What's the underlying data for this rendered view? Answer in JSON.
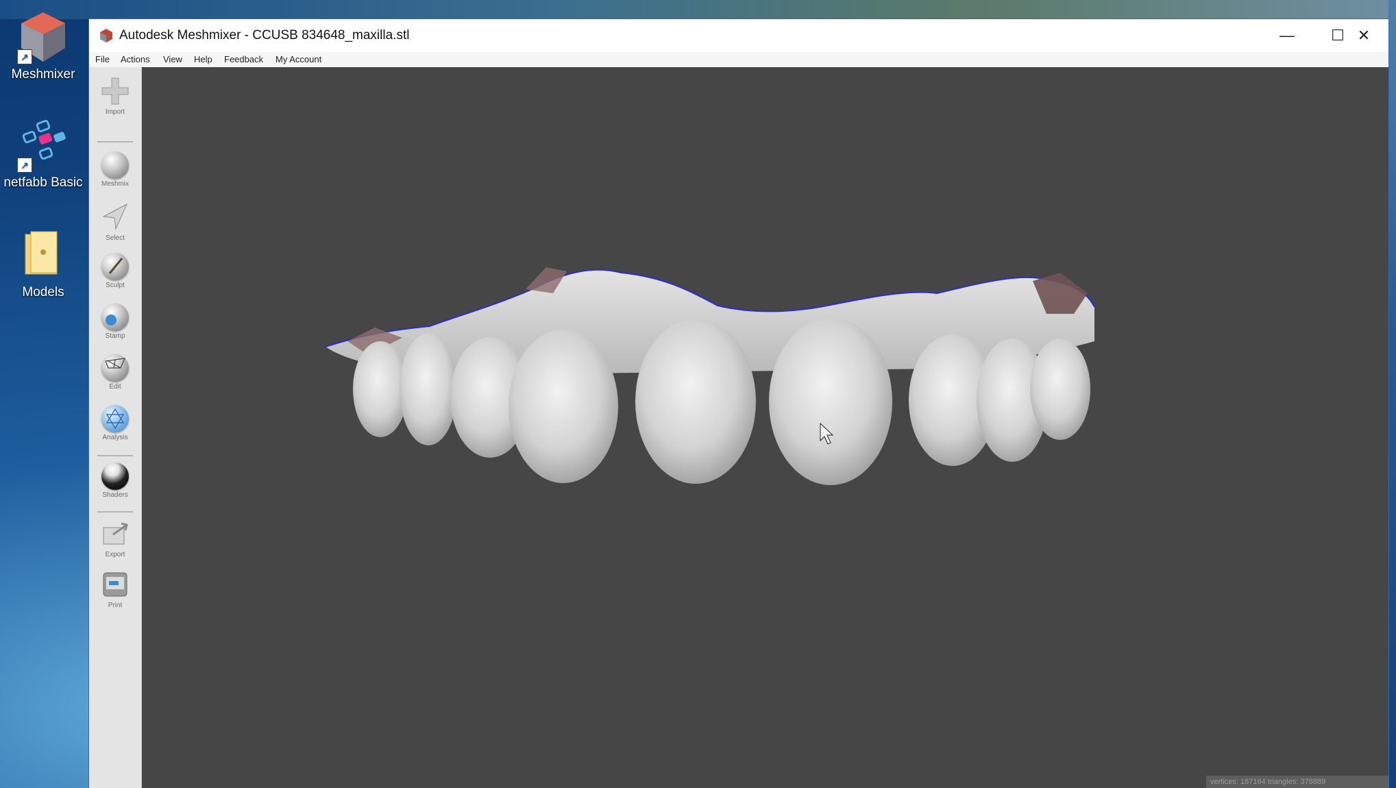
{
  "desktop": {
    "icons": [
      {
        "label": "Meshmixer",
        "icon": "meshmixer-icon"
      },
      {
        "label": "netfabb Basic",
        "icon": "netfabb-icon"
      },
      {
        "label": "Models",
        "icon": "folder-icon"
      }
    ]
  },
  "window": {
    "title": "Autodesk Meshmixer - CCUSB 834648_maxilla.stl",
    "controls": {
      "minimize": "—",
      "maximize": "☐",
      "close": "✕"
    }
  },
  "menu": [
    "File",
    "Actions",
    "View",
    "Help",
    "Feedback",
    "My Account"
  ],
  "toolbar": [
    {
      "label": "Import",
      "icon": "import-plus-icon"
    },
    {
      "label": "Meshmix",
      "icon": "meshmix-sphere-icon"
    },
    {
      "label": "Select",
      "icon": "select-arrow-icon"
    },
    {
      "label": "Sculpt",
      "icon": "sculpt-brush-icon"
    },
    {
      "label": "Stamp",
      "icon": "stamp-icon"
    },
    {
      "label": "Edit",
      "icon": "edit-sphere-icon"
    },
    {
      "label": "Analysis",
      "icon": "analysis-sphere-icon"
    },
    {
      "label": "Shaders",
      "icon": "shaders-sphere-icon"
    },
    {
      "label": "Export",
      "icon": "export-icon"
    },
    {
      "label": "Print",
      "icon": "print-icon"
    }
  ],
  "viewport": {
    "model": "dental maxilla scan",
    "status": "vertices: 187164  triangles: 378889"
  },
  "colors": {
    "viewport_bg": "#464646",
    "mesh": "#d9d9d9",
    "boundary": "#2b2bd8",
    "gum": "#8c6b6b"
  }
}
